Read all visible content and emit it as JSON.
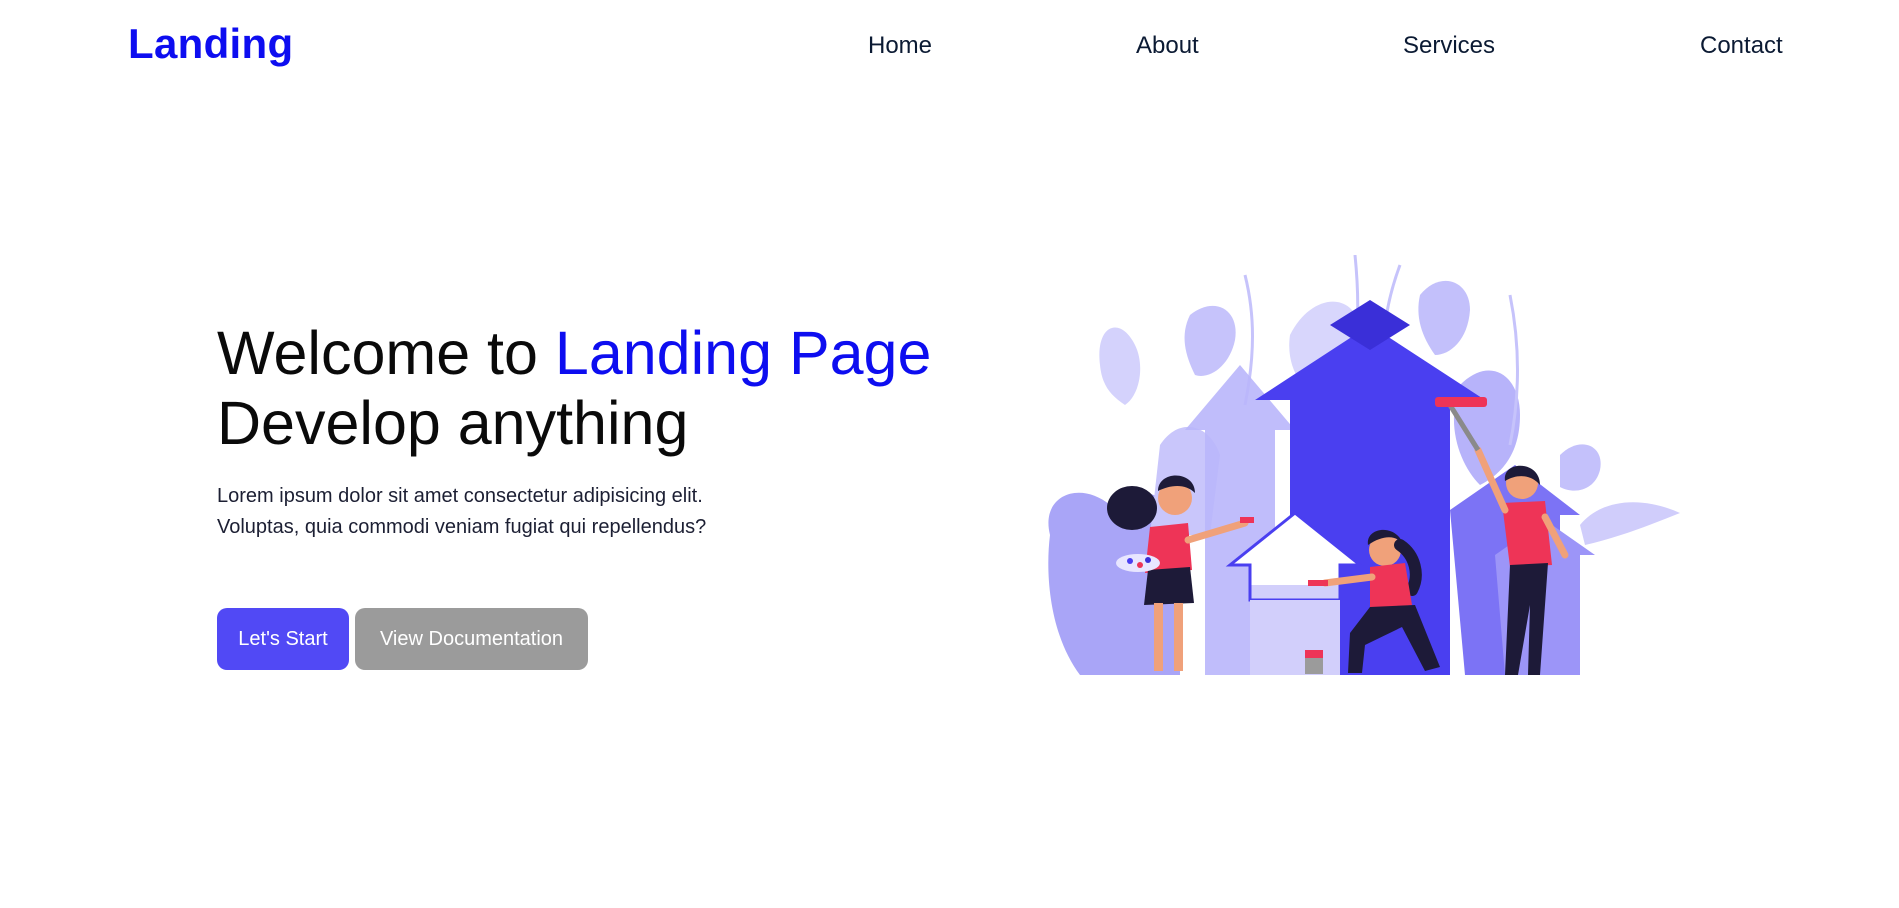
{
  "header": {
    "logo": "Landing",
    "nav": [
      {
        "label": "Home"
      },
      {
        "label": "About"
      },
      {
        "label": "Services"
      },
      {
        "label": "Contact"
      }
    ]
  },
  "hero": {
    "title_prefix": "Welcome to ",
    "title_accent": "Landing Page",
    "title_line2": "Develop anything",
    "description_line1": "Lorem ipsum dolor sit amet consectetur adipisicing elit.",
    "description_line2": "Voluptas, quia commodi veniam fugiat qui repellendus?",
    "primary_button": "Let's Start",
    "secondary_button": "View Documentation"
  },
  "colors": {
    "brand": "#0d0df0",
    "primary_button": "#5149f5",
    "secondary_button": "#9b9b9b",
    "illustration_accent": "#ee3457"
  },
  "illustration": {
    "icon": "team-painting-house-illustration"
  }
}
